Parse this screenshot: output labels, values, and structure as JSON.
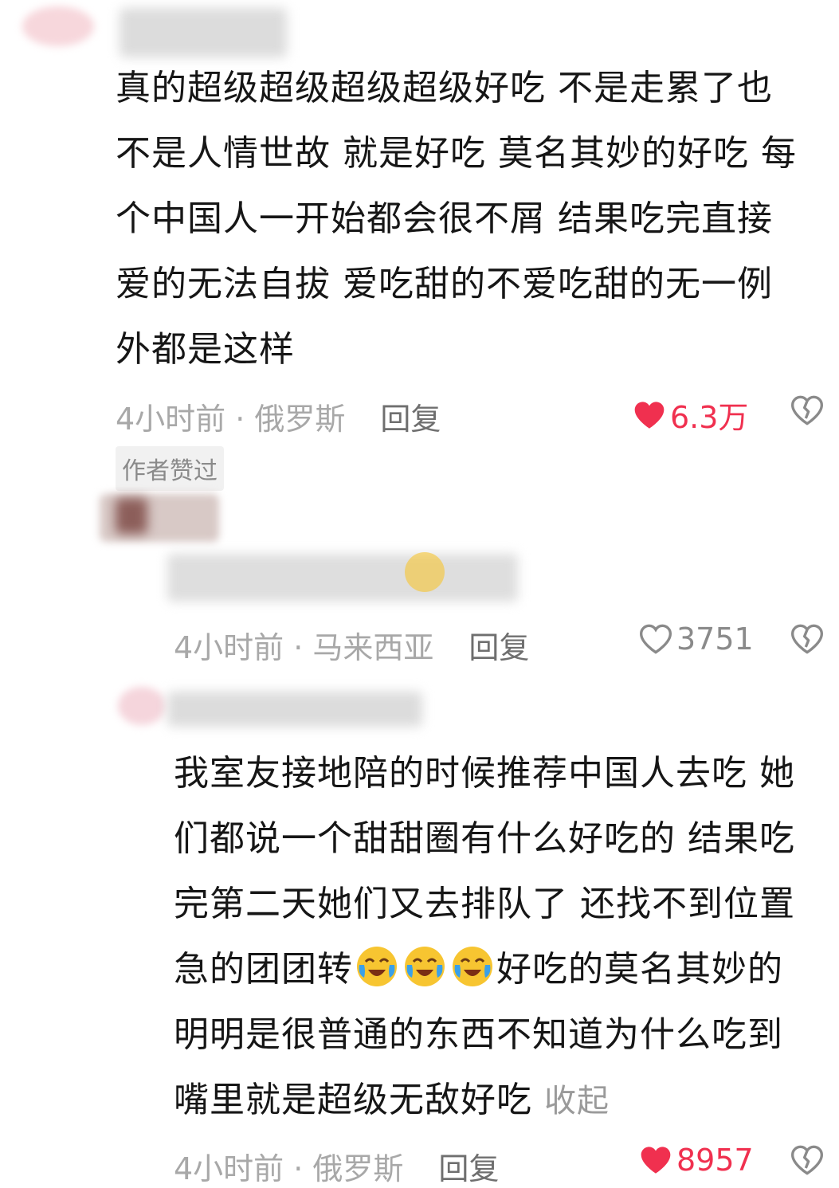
{
  "comments": [
    {
      "body": "真的超级超级超级超级好吃 不是走累了也\n不是人情世故 就是好吃 莫名其妙的好吃 每\n个中国人一开始都会很不屑 结果吃完直接\n爱的无法自拔 爱吃甜的不爱吃甜的无一例\n外都是这样",
      "time_location": "4小时前 · 俄罗斯",
      "reply_label": "回复",
      "like_count": "6.3万",
      "liked": true,
      "badge": "作者赞过"
    },
    {
      "time_location": "4小时前 · 马来西亚",
      "reply_label": "回复",
      "like_count": "3751",
      "liked": false
    },
    {
      "body_lines": [
        "我室友接地陪的时候推荐中国人去吃 她",
        "们都说一个甜甜圈有什么好吃的 结果吃",
        "完第二天她们又去排队了 还找不到位置",
        "急的团团转",
        "好吃的莫名其妙的",
        "明明是很普通的东西不知道为什么吃到",
        "嘴里就是超级无敌好吃"
      ],
      "collapse_label": "收起",
      "time_location": "4小时前 · 俄罗斯",
      "reply_label": "回复",
      "like_count": "8957",
      "liked": true
    }
  ],
  "colors": {
    "liked": "#f0304f",
    "meta": "#a8a8a8",
    "text": "#161616"
  },
  "icons": {
    "like": "heart-icon",
    "dislike": "broken-heart-icon",
    "emoji": "crying-laughing-emoji"
  }
}
